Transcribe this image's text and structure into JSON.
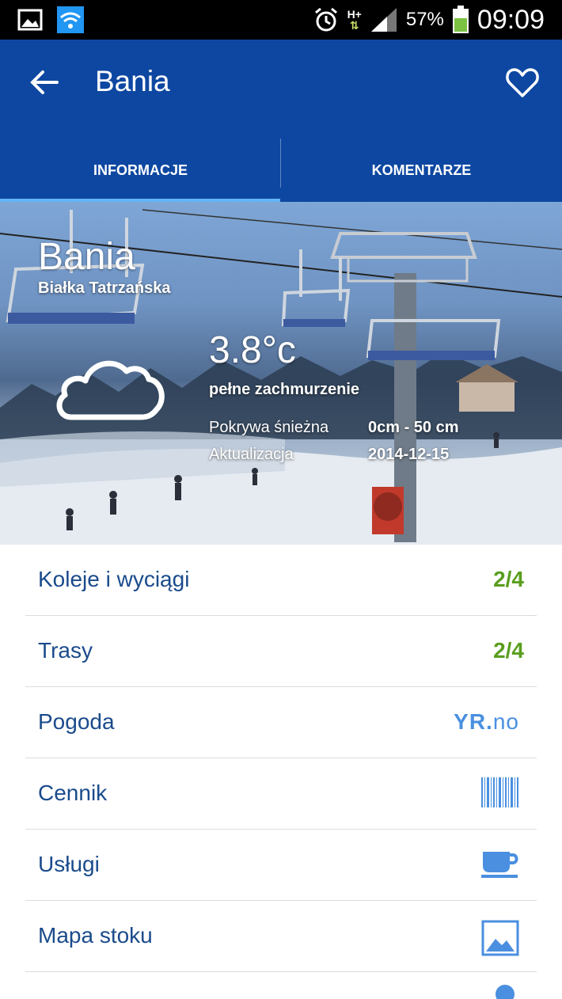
{
  "status_bar": {
    "battery_percent": "57%",
    "time": "09:09",
    "network_type": "H+"
  },
  "app_bar": {
    "title": "Bania",
    "back_icon": "arrow-left-icon",
    "favorite_icon": "heart-outline-icon"
  },
  "tabs": [
    {
      "label": "INFORMACJE",
      "active": true
    },
    {
      "label": "KOMENTARZE",
      "active": false
    }
  ],
  "hero": {
    "name": "Bania",
    "location": "Białka Tatrzańska",
    "temperature": "3.8°c",
    "condition": "pełne zachmurzenie",
    "weather_icon": "cloud-icon",
    "snow_label": "Pokrywa śnieżna",
    "snow_value": "0cm - 50 cm",
    "update_label": "Aktualizacja",
    "update_value": "2014-12-15"
  },
  "list": [
    {
      "label": "Koleje i wyciągi",
      "value": "2/4"
    },
    {
      "label": "Trasy",
      "value": "2/4"
    },
    {
      "label": "Pogoda",
      "badge_prefix": "YR.",
      "badge_suffix": "no"
    },
    {
      "label": "Cennik",
      "icon": "barcode-icon"
    },
    {
      "label": "Usługi",
      "icon": "coffee-cup-icon"
    },
    {
      "label": "Mapa stoku",
      "icon": "image-icon"
    }
  ],
  "colors": {
    "app_bar": "#0d47a1",
    "tab_indicator": "#64b5f6",
    "list_label": "#1a4b8c",
    "list_value": "#5a9e1f",
    "list_icon": "#4a8fe0"
  }
}
